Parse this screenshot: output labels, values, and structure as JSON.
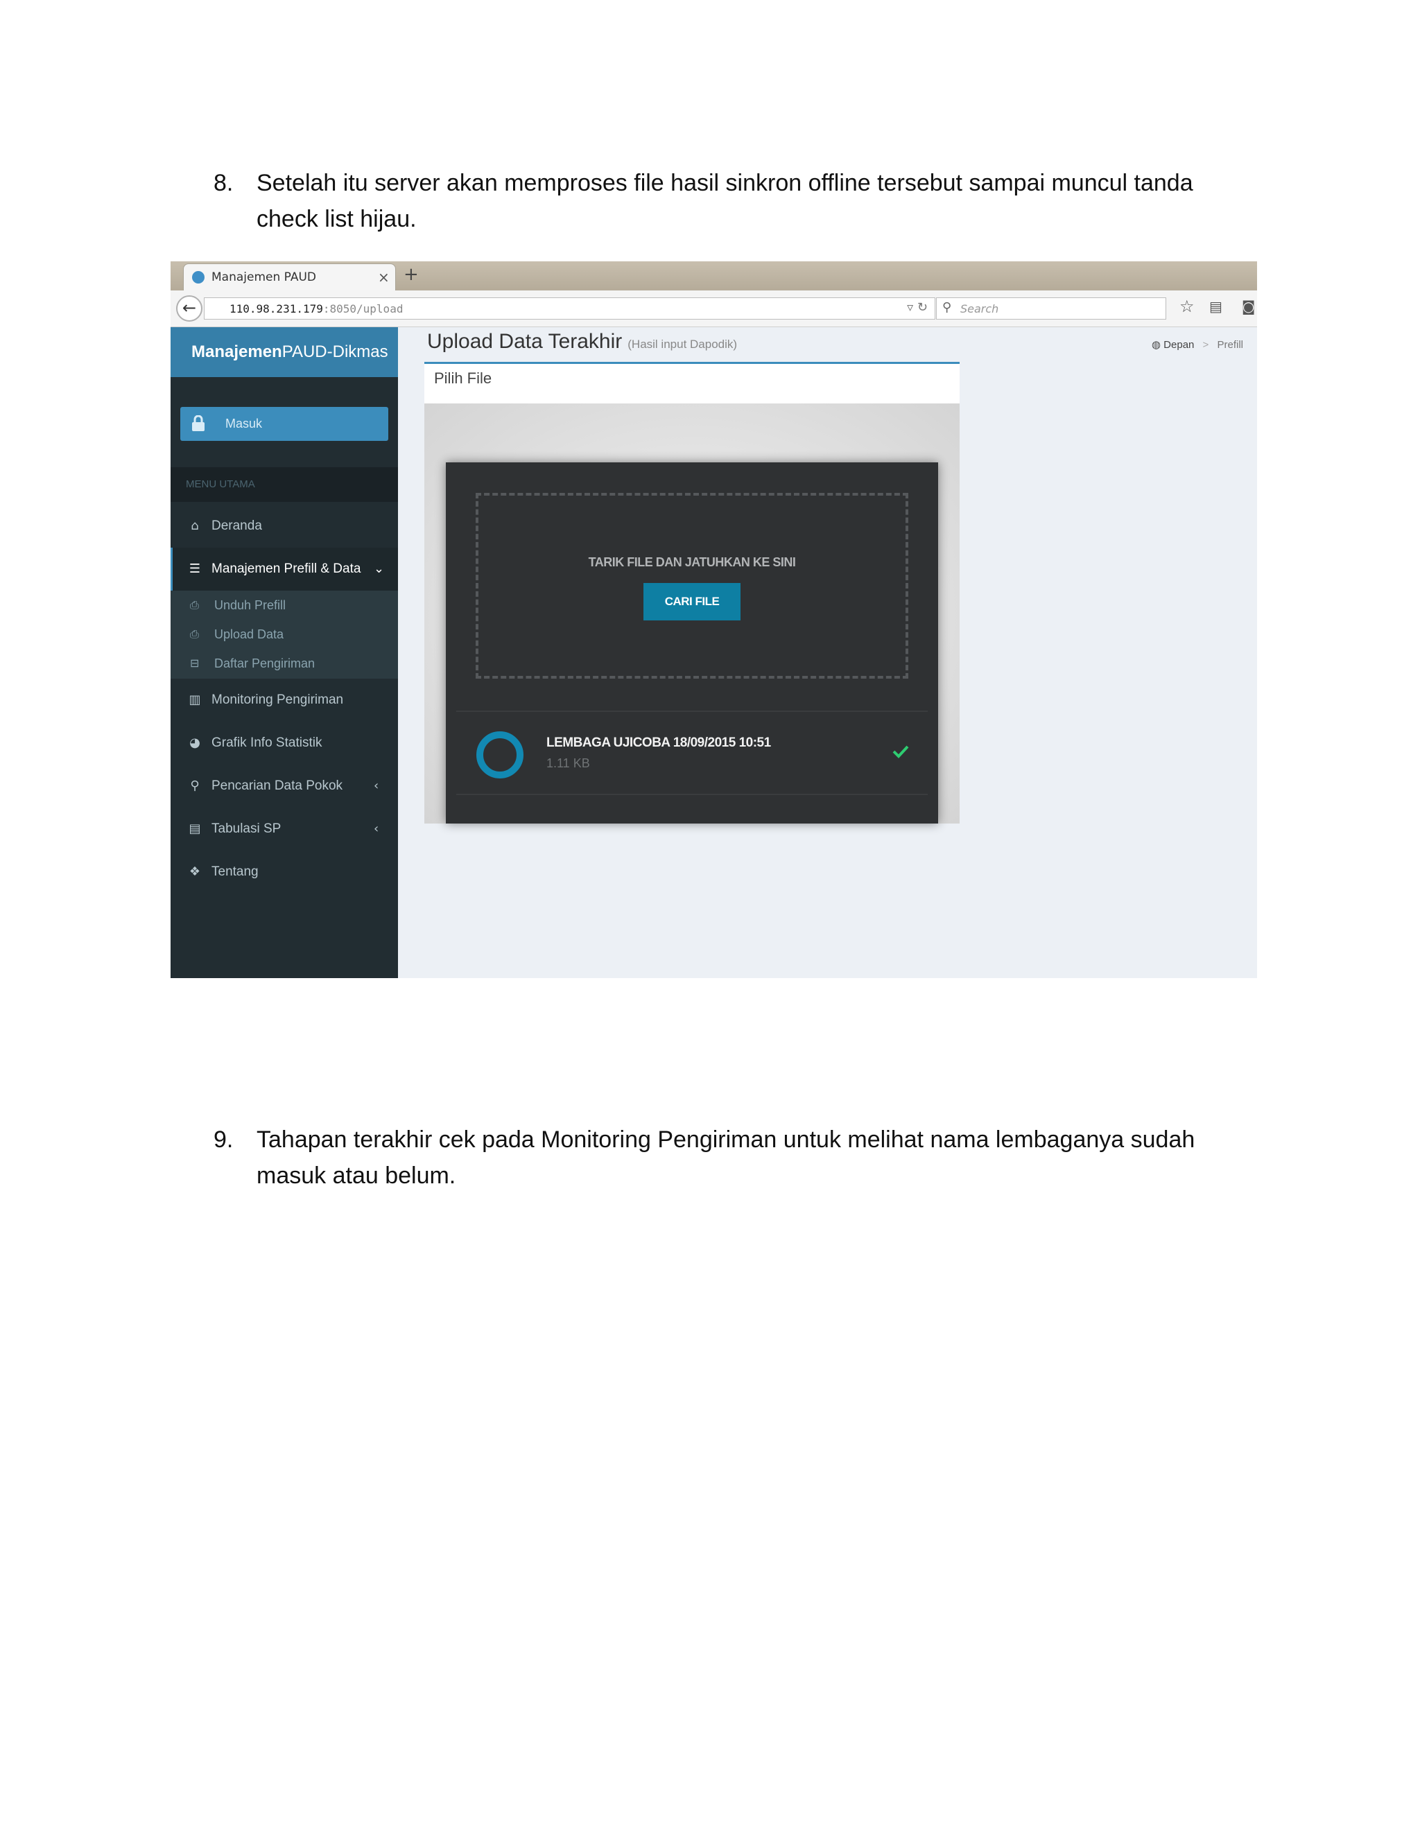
{
  "steps": [
    {
      "number": "8.",
      "text": "Setelah itu server akan memproses file hasil sinkron offline tersebut sampai muncul tanda check list hijau."
    },
    {
      "number": "9.",
      "text": "Tahapan terakhir cek pada Monitoring Pengiriman untuk melihat nama lembaganya sudah masuk atau belum."
    }
  ],
  "browser": {
    "tab_title": "Manajemen PAUD",
    "url_main": "110.98.231.179",
    "url_rest": ":8050/upload",
    "search_placeholder": "Search"
  },
  "app": {
    "logo_bold": "Manajemen",
    "logo_rest": "PAUD-Dikmas",
    "login_label": "Masuk",
    "menu_header": "MENU UTAMA",
    "menu": [
      {
        "label": "Deranda",
        "icon": "home-icon"
      },
      {
        "label": "Manajemen Prefill & Data",
        "icon": "sliders-icon",
        "active": true
      },
      {
        "label": "Monitoring Pengiriman",
        "icon": "bar-chart-icon"
      },
      {
        "label": "Grafik Info Statistik",
        "icon": "pie-chart-icon"
      },
      {
        "label": "Pencarian Data Pokok",
        "icon": "search-icon"
      },
      {
        "label": "Tabulasi SP",
        "icon": "table-icon"
      },
      {
        "label": "Tentang",
        "icon": "cubes-icon"
      }
    ],
    "submenu": [
      {
        "label": "Unduh Prefill"
      },
      {
        "label": "Upload Data"
      },
      {
        "label": "Daftar Pengiriman"
      }
    ],
    "page_title": "Upload Data Terakhir",
    "page_subtitle": "(Hasil input Dapodik)",
    "breadcrumb": [
      "Depan",
      "Prefill"
    ],
    "panel_title": "Pilih File",
    "dropzone_text": "TARIK FILE DAN JATUHKAN KE SINI",
    "browse_button": "CARI FILE",
    "file": {
      "name": "LEMBAGA UJICOBA 18/09/2015 10:51",
      "size": "1.11 KB",
      "status": "done"
    },
    "colors": {
      "sidebar": "#222d32",
      "logo_bg": "#367fa9",
      "primary": "#3c8dbc",
      "accent_button": "#0e7fa3",
      "success": "#2ecc71"
    }
  }
}
